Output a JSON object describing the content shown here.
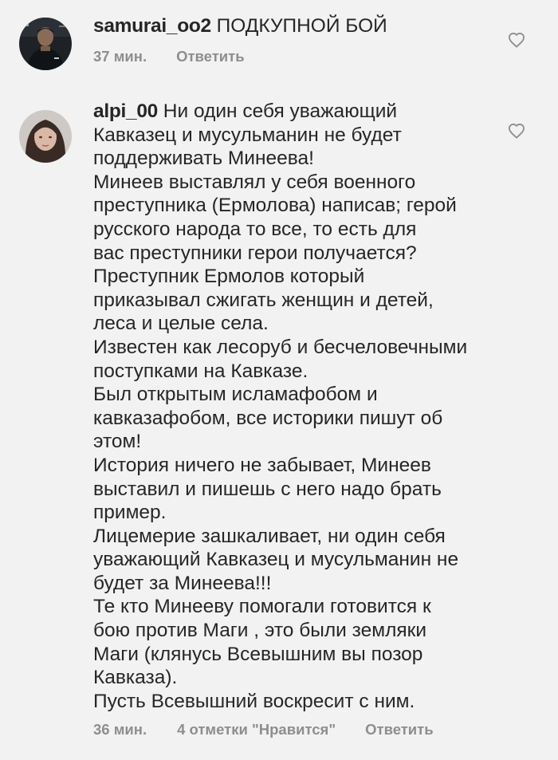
{
  "comments": [
    {
      "username": "samurai_oo2",
      "text": "ПОДКУПНОЙ БОЙ",
      "time": "37 мин.",
      "reply_label": "Ответить",
      "avatar_icon": "user-avatar-fighter"
    },
    {
      "username": "alpi_00",
      "text": "Ни один себя уважающий\nКавказец и мусульманин не будет\nподдерживать Минеева!\nМинеев выставлял у себя военного\nпреступника (Ермолова) написав; герой\nрусского народа то все, то есть для\nвас преступники герои получается?\nПреступник Ермолов который\nприказывал сжигать женщин и детей,\nлеса и целые села.\nИзвестен как лесоруб и бесчеловечными\nпоступками на Кавказе.\nБыл открытым исламафобом и\nкавказафобом, все  историки пишут об\nэтом!\nИстория ничего не забывает, Минеев\nвыставил и пишешь с него надо брать\nпример.\nЛицемерие зашкаливает, ни один себя\nуважающий Кавказец и мусульманин не\nбудет за Минеева!!!\nТе кто Минееву  помогали готовится к\nбою против Маги , это были земляки\nМаги (клянусь Всевышним вы позор\nКавказа).\nПусть Всевышний воскресит с ним.",
      "time": "36 мин.",
      "likes_label": "4 отметки \"Нравится\"",
      "reply_label": "Ответить",
      "avatar_icon": "user-avatar-woman"
    }
  ],
  "icons": {
    "like": "heart-outline-icon"
  },
  "colors": {
    "background": "#f2f2f2",
    "text": "#262626",
    "meta": "#8e8e8e"
  }
}
